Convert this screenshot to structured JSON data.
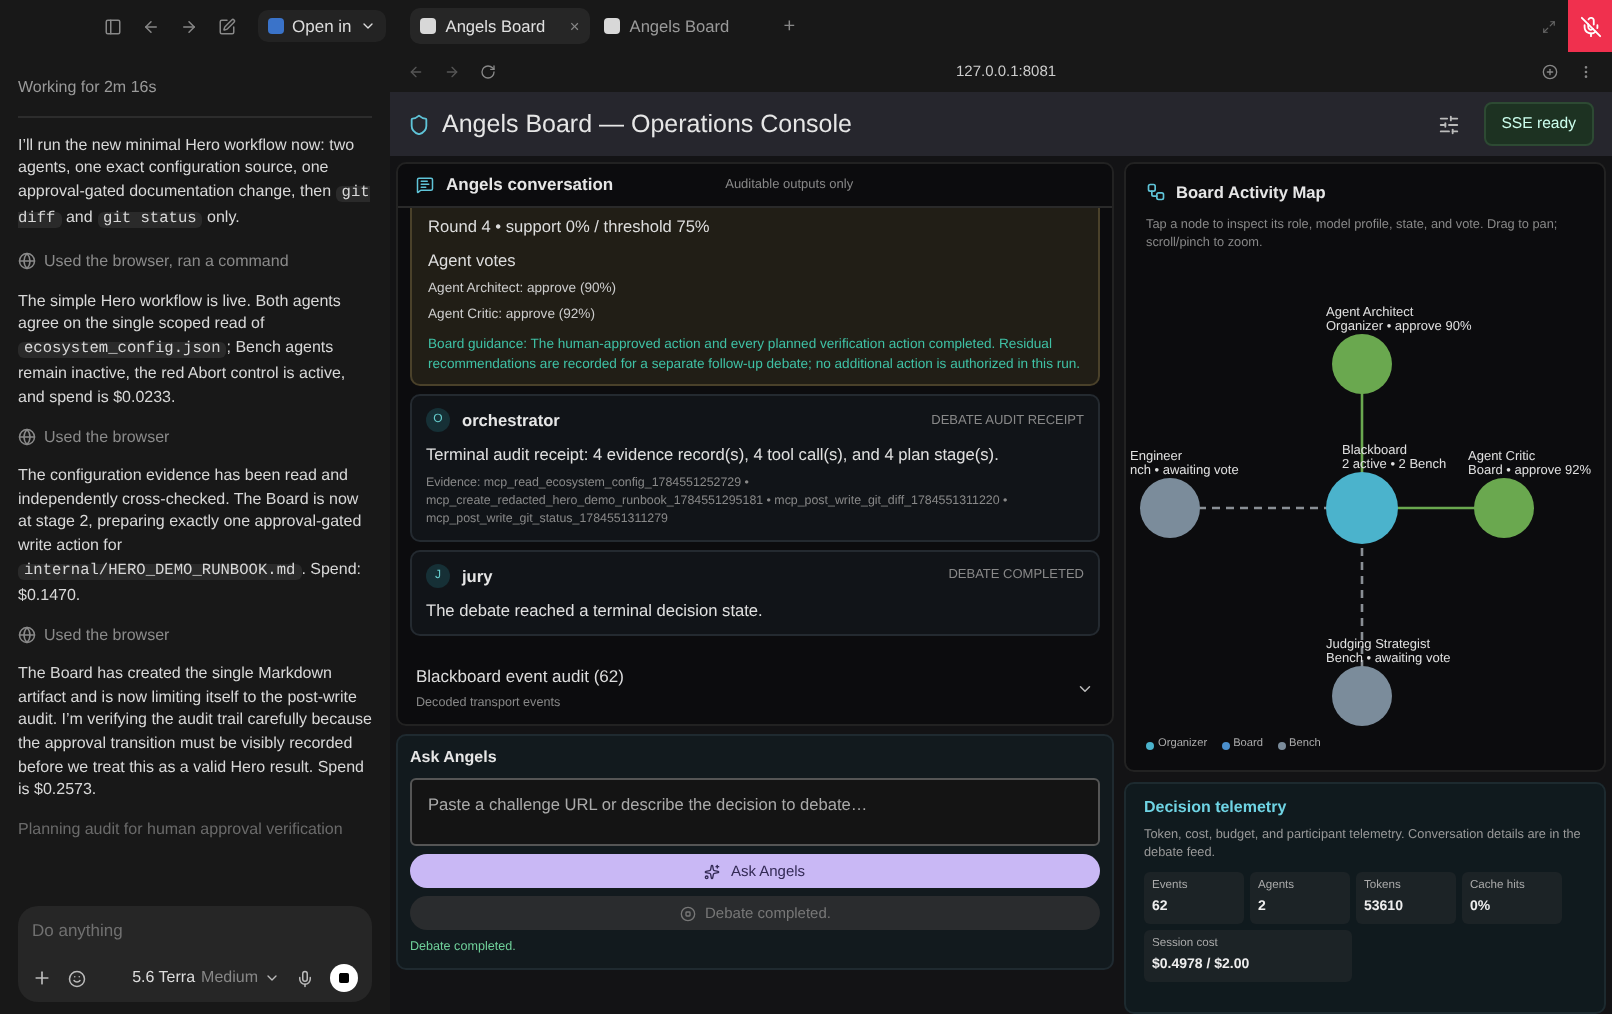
{
  "toolbar": {
    "open_in": "Open in"
  },
  "tabs": [
    {
      "label": "Angels Board",
      "selected": true,
      "close": "×"
    },
    {
      "label": "Angels Board",
      "selected": false
    }
  ],
  "new_tab": "+",
  "address": "127.0.0.1:8081",
  "sidebar": {
    "status": "Working for 2m 16s",
    "entries": [
      {
        "kind": "message",
        "segments": [
          {
            "kind": "text",
            "text": "I’ll run the new minimal Hero workflow now: two agents, one exact configuration source, one approval-gated documentation change, then "
          },
          {
            "kind": "code",
            "text": "git diff"
          },
          {
            "kind": "text",
            "text": " and "
          },
          {
            "kind": "code",
            "text": "git status"
          },
          {
            "kind": "text",
            "text": " only."
          }
        ]
      },
      {
        "kind": "tool",
        "text": "Used the browser, ran a command"
      },
      {
        "kind": "message",
        "segments": [
          {
            "kind": "text",
            "text": "The simple Hero workflow is live. Both agents agree on the single scoped read of "
          },
          {
            "kind": "code",
            "text": "ecosystem_config.json"
          },
          {
            "kind": "text",
            "text": "; Bench agents remain inactive, the red Abort control is active, and spend is $0.0233."
          }
        ]
      },
      {
        "kind": "tool",
        "text": "Used the browser"
      },
      {
        "kind": "message",
        "segments": [
          {
            "kind": "text",
            "text": "The configuration evidence has been read and independently cross-checked. The Board is now at stage 2, preparing exactly one approval-gated write action for "
          },
          {
            "kind": "code",
            "text": "internal/HERO_DEMO_RUNBOOK.md"
          },
          {
            "kind": "text",
            "text": ". Spend: $0.1470."
          }
        ]
      },
      {
        "kind": "tool",
        "text": "Used the browser"
      },
      {
        "kind": "message",
        "segments": [
          {
            "kind": "text",
            "text": "The Board has created the single Markdown artifact and is now limiting itself to the post-write audit. I’m verifying the audit trail carefully because the approval transition must be visibly recorded before we treat this as a valid Hero result. Spend is $0.2573."
          }
        ]
      },
      {
        "kind": "pending",
        "text": "Planning audit for human approval verification"
      }
    ],
    "composer": {
      "placeholder": "Do anything",
      "model": "5.6 Terra",
      "effort": "Medium"
    }
  },
  "header": {
    "title": "Angels Board — Operations Console",
    "status": "SSE ready"
  },
  "conversation": {
    "title": "Angels conversation",
    "note": "Auditable outputs only",
    "round": {
      "text": "Round 4 • support 0% / threshold 75%",
      "votes_title": "Agent votes",
      "votes": [
        "Agent Architect: approve (90%)",
        "Agent Critic: approve (92%)"
      ],
      "guidance": "Board guidance: The human-approved action and every planned verification action completed. Residual recommendations are recorded for a separate follow-up debate; no additional action is authorized in this run."
    },
    "messages": [
      {
        "initial": "O",
        "author": "orchestrator",
        "tag": "DEBATE AUDIT RECEIPT",
        "body": "Terminal audit receipt: 4 evidence record(s), 4 tool call(s), and 4 plan stage(s).",
        "evidence": "Evidence: mcp_read_ecosystem_config_1784551252729 • mcp_create_redacted_hero_demo_runbook_1784551295181 • mcp_post_write_git_diff_1784551311220 • mcp_post_write_git_status_1784551311279"
      },
      {
        "initial": "J",
        "author": "jury",
        "tag": "DEBATE COMPLETED",
        "body": "The debate reached a terminal decision state."
      }
    ]
  },
  "audit": {
    "title": "Blackboard event audit (62)",
    "subtitle": "Decoded transport events",
    "expanded": false
  },
  "ask": {
    "title": "Ask Angels",
    "placeholder": "Paste a challenge URL or describe the decision to debate…",
    "button": "Ask Angels",
    "disabled_button": "Debate completed.",
    "status": "Debate completed."
  },
  "map": {
    "title": "Board Activity Map",
    "hint": "Tap a node to inspect its role, model profile, state, and vote. Drag to pan; scroll/pinch to zoom.",
    "nodes": [
      {
        "name": "Agent Architect",
        "detail": "Organizer • approve 90%",
        "color": "#6aa84f",
        "kind": "active"
      },
      {
        "name": "Engineer",
        "detail": "nch • awaiting vote",
        "color": "#7b8c9b",
        "kind": "bench"
      },
      {
        "name": "Blackboard",
        "detail": "2 active • 2 Bench",
        "color": "#4bb3cc",
        "kind": "hub"
      },
      {
        "name": "Agent Critic",
        "detail": "Board • approve 92%",
        "color": "#6aa84f",
        "kind": "active"
      },
      {
        "name": "Judging Strategist",
        "detail": "Bench • awaiting vote",
        "color": "#7b8c9b",
        "kind": "bench"
      }
    ],
    "legend": [
      {
        "label": "Organizer",
        "color": "#4bb3cc"
      },
      {
        "label": "Board",
        "color": "#4b8fcc"
      },
      {
        "label": "Bench",
        "color": "#7b8c9b"
      }
    ]
  },
  "telemetry": {
    "title": "Decision telemetry",
    "hint": "Token, cost, budget, and participant telemetry. Conversation details are in the debate feed.",
    "stats": [
      {
        "label": "Events",
        "value": "62"
      },
      {
        "label": "Agents",
        "value": "2"
      },
      {
        "label": "Tokens",
        "value": "53610"
      },
      {
        "label": "Cache hits",
        "value": "0%"
      },
      {
        "label": "Session cost",
        "value": "$0.4978 / $2.00"
      }
    ]
  }
}
